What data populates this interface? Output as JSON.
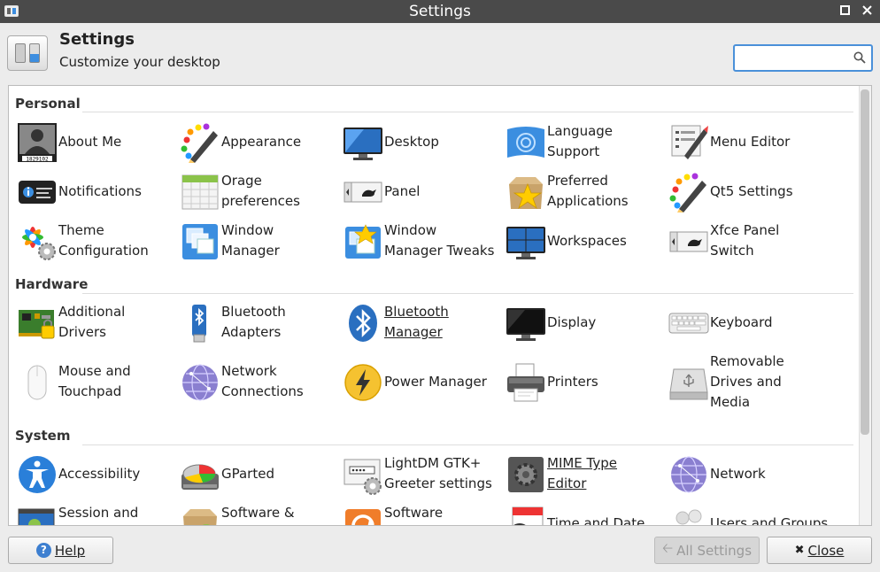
{
  "window": {
    "title": "Settings"
  },
  "header": {
    "title": "Settings",
    "subtitle": "Customize your desktop"
  },
  "search": {
    "value": "",
    "placeholder": ""
  },
  "categories": {
    "personal": "Personal",
    "hardware": "Hardware",
    "system": "System"
  },
  "personal": [
    {
      "l1": "About Me",
      "l2": ""
    },
    {
      "l1": "Appearance",
      "l2": ""
    },
    {
      "l1": "Desktop",
      "l2": ""
    },
    {
      "l1": "Language",
      "l2": "Support"
    },
    {
      "l1": "Menu Editor",
      "l2": ""
    },
    {
      "l1": "Notifications",
      "l2": ""
    },
    {
      "l1": "Orage",
      "l2": "preferences"
    },
    {
      "l1": "Panel",
      "l2": ""
    },
    {
      "l1": "Preferred",
      "l2": "Applications"
    },
    {
      "l1": "Qt5 Settings",
      "l2": ""
    },
    {
      "l1": "Theme",
      "l2": "Configuration"
    },
    {
      "l1": "Window",
      "l2": "Manager"
    },
    {
      "l1": "Window",
      "l2": "Manager Tweaks"
    },
    {
      "l1": "Workspaces",
      "l2": ""
    },
    {
      "l1": "Xfce Panel",
      "l2": "Switch"
    }
  ],
  "hardware": [
    {
      "l1": "Additional",
      "l2": "Drivers"
    },
    {
      "l1": "Bluetooth",
      "l2": "Adapters"
    },
    {
      "l1": "Bluetooth",
      "l2": "Manager"
    },
    {
      "l1": "Display",
      "l2": ""
    },
    {
      "l1": "Keyboard",
      "l2": ""
    },
    {
      "l1": "Mouse and",
      "l2": "Touchpad"
    },
    {
      "l1": "Network",
      "l2": "Connections"
    },
    {
      "l1": "Power Manager",
      "l2": ""
    },
    {
      "l1": "Printers",
      "l2": ""
    },
    {
      "l1": "Removable",
      "l2": "Drives and",
      "l3": "Media"
    }
  ],
  "system": [
    {
      "l1": "Accessibility",
      "l2": ""
    },
    {
      "l1": "GParted",
      "l2": ""
    },
    {
      "l1": "LightDM GTK+",
      "l2": "Greeter settings"
    },
    {
      "l1": "MIME Type",
      "l2": "Editor"
    },
    {
      "l1": "Network",
      "l2": ""
    },
    {
      "l1": "Session and",
      "l2": ""
    },
    {
      "l1": "Software &",
      "l2": ""
    },
    {
      "l1": "Software",
      "l2": ""
    },
    {
      "l1": "Time and Date",
      "l2": ""
    },
    {
      "l1": "Users and Groups",
      "l2": ""
    }
  ],
  "footer": {
    "help": "Help",
    "all_settings": "All Settings",
    "close": "Close"
  }
}
